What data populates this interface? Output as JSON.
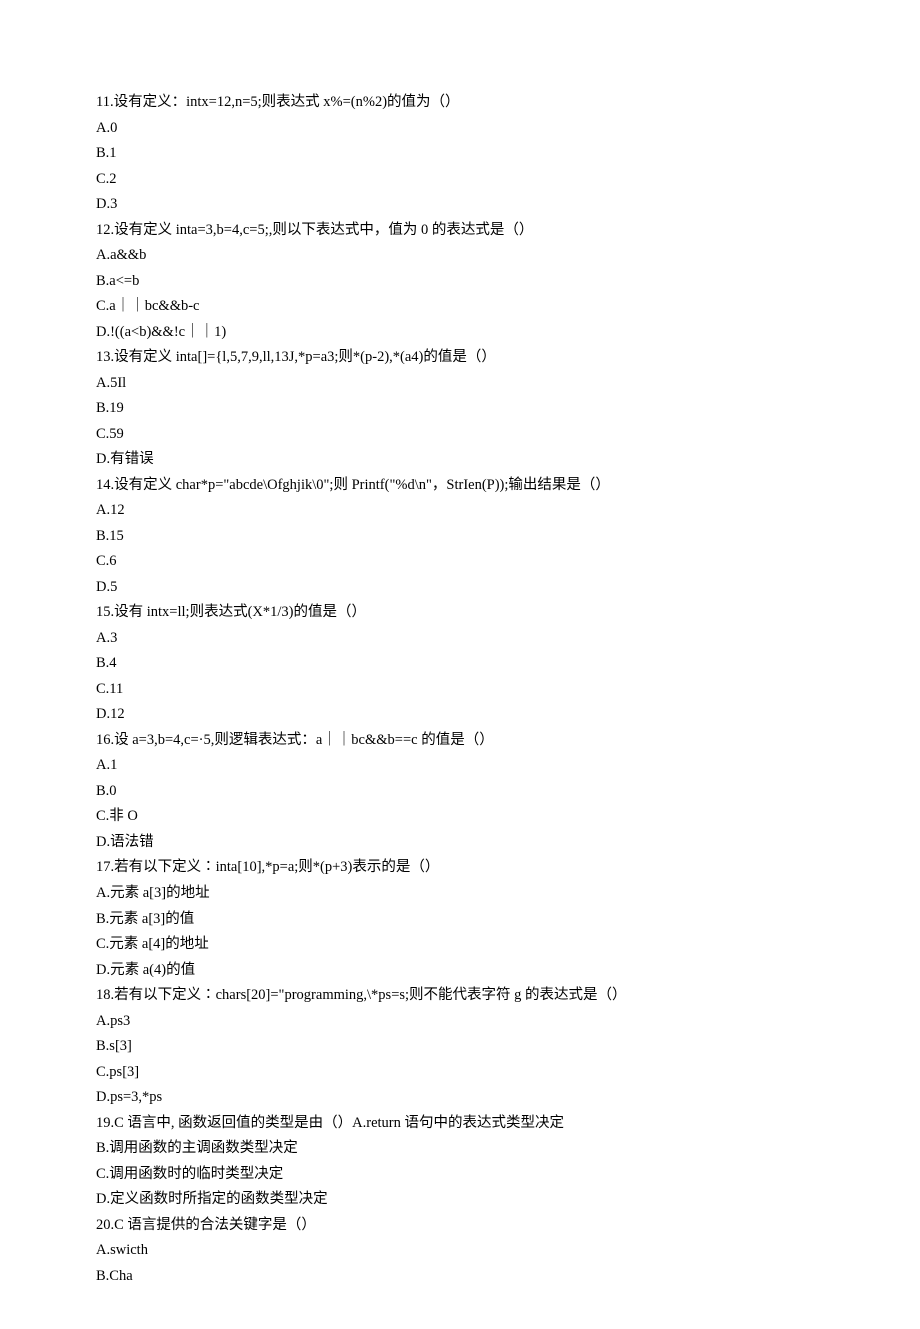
{
  "questions": [
    {
      "num": "11",
      "stem": "设有定义：intx=12,n=5;则表达式 x%=(n%2)的值为（）",
      "options": [
        "A.0",
        "B.1",
        "C.2",
        "D.3"
      ]
    },
    {
      "num": "12",
      "stem": "设有定义 inta=3,b=4,c=5;,则以下表达式中，值为 0 的表达式是（）",
      "options": [
        "A.a&&b",
        "B.a<=b",
        "C.a｜｜bc&&b-c",
        "D.!((a<b)&&!c｜｜1)"
      ]
    },
    {
      "num": "13",
      "stem": "设有定义 inta[]={l,5,7,9,ll,13J,*p=a3;则*(p-2),*(a4)的值是（）",
      "options": [
        "A.5Il",
        "B.19",
        "C.59",
        "D.有错误"
      ]
    },
    {
      "num": "14",
      "stem": "设有定义 char*p=\"abcde\\Ofghjik\\0\";则 Printf(\"%d\\n\"，StrIen(P));输出结果是（）",
      "options": [
        "A.12",
        "B.15",
        "C.6",
        "D.5"
      ]
    },
    {
      "num": "15",
      "stem": "设有 intx=ll;则表达式(X*1/3)的值是（）",
      "options": [
        "A.3",
        "B.4",
        "C.11",
        "D.12"
      ]
    },
    {
      "num": "16",
      "stem": "设 a=3,b=4,c=·5,则逻辑表达式：a｜｜bc&&b==c 的值是（）",
      "options": [
        "A.1",
        "B.0",
        "C.非 O",
        "D.语法错"
      ]
    },
    {
      "num": "17",
      "stem": "若有以下定义∶inta[10],*p=a;则*(p+3)表示的是（）",
      "options": [
        "A.元素 a[3]的地址",
        "B.元素 a[3]的值",
        "C.元素 a[4]的地址",
        "D.元素 a(4)的值"
      ]
    },
    {
      "num": "18",
      "stem": "若有以下定义∶chars[20]=\"programming,\\*ps=s;则不能代表字符 g 的表达式是（）",
      "options": [
        "A.ps3",
        "B.s[3]",
        "C.ps[3]",
        "D.ps=3,*ps"
      ]
    },
    {
      "num": "19",
      "stem": "C 语言中, 函数返回值的类型是由（）A.return 语句中的表达式类型决定",
      "options": [
        "B.调用函数的主调函数类型决定",
        "C.调用函数时的临时类型决定",
        "D.定义函数时所指定的函数类型决定"
      ]
    },
    {
      "num": "20",
      "stem": "C 语言提供的合法关键字是（）",
      "options": [
        "A.swicth",
        "B.Cha"
      ]
    }
  ]
}
